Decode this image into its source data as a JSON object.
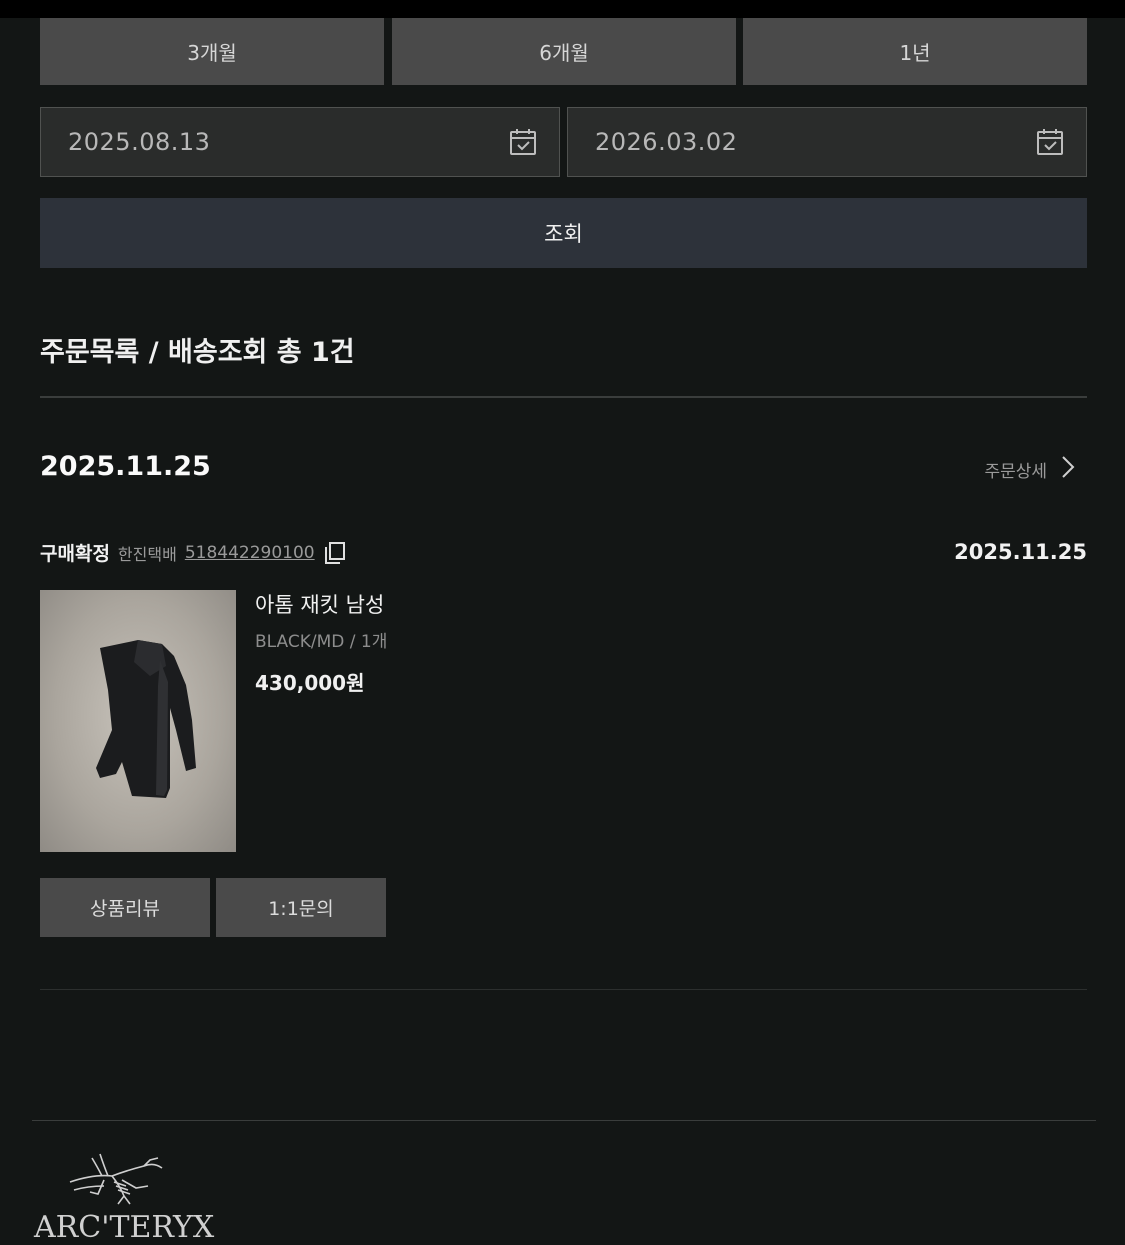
{
  "period_buttons": [
    "3개월",
    "6개월",
    "1년"
  ],
  "date_range": {
    "start": "2025.08.13",
    "end": "2026.03.02"
  },
  "search_label": "조회",
  "section_title": "주문목록 / 배송조회 총 1건",
  "order": {
    "date": "2025.11.25",
    "detail_label": "주문상세",
    "status": "구매확정",
    "courier": "한진택배",
    "tracking_number": "518442290100",
    "status_date": "2025.11.25",
    "product": {
      "name": "아톰 재킷 남성",
      "options": "BLACK/MD / 1개",
      "price": "430,000원"
    },
    "actions": [
      "상품리뷰",
      "1:1문의"
    ]
  },
  "footer": {
    "brand": "ARC'TERYX"
  }
}
